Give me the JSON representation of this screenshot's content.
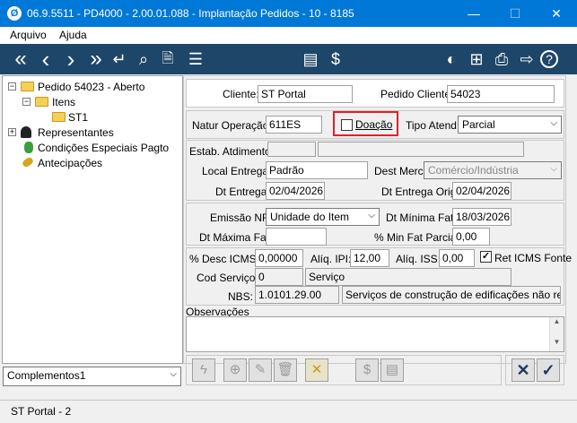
{
  "window": {
    "title": "06.9.5511 - PD4000 - 2.00.01.088 - Implantação Pedidos - 10 - 8185",
    "icon": "app-logo-icon",
    "minimize": "—",
    "maximize": "☐",
    "close": "✕"
  },
  "menu": {
    "arquivo": "Arquivo",
    "ajuda": "Ajuda"
  },
  "toolbar": {
    "first": "«",
    "prev": "‹",
    "next": "›",
    "last": "»",
    "return": "↵",
    "search": "⌕",
    "doc": "🗎",
    "filters": "☰",
    "report": "▤",
    "money": "$",
    "globe": "◐",
    "grid": "⊞",
    "print": "⎙",
    "exit": "⇨",
    "help": "?"
  },
  "tree": {
    "items": [
      {
        "label": "Pedido 54023 - Aberto"
      },
      {
        "label": "Itens"
      },
      {
        "label": "ST1"
      },
      {
        "label": "Representantes"
      },
      {
        "label": "Condições Especiais Pagto"
      },
      {
        "label": "Antecipações"
      }
    ]
  },
  "complementos": {
    "value": "Complementos1"
  },
  "cliente": {
    "label": "Cliente:",
    "value": "ST Portal"
  },
  "pedido_cliente": {
    "label": "Pedido Cliente:",
    "value": "54023"
  },
  "natur_operacao": {
    "label": "Natur Operação:",
    "value": "611ES"
  },
  "doacao": {
    "label": "Doação",
    "checked": false
  },
  "tipo_atend": {
    "label": "Tipo Atend:",
    "value": "Parcial"
  },
  "estab_atendimento": {
    "label": "Estab. Atdimento:",
    "value": ""
  },
  "local_entrega": {
    "label": "Local Entrega:",
    "value": "Padrão"
  },
  "dest_merc": {
    "label": "Dest Merc:",
    "value": "Comércio/Indústria"
  },
  "dt_entrega": {
    "label": "Dt Entrega:",
    "value": "02/04/2026"
  },
  "dt_entrega_orig": {
    "label": "Dt Entrega Orig:",
    "value": "02/04/2026"
  },
  "emissao_nf": {
    "label": "Emissão NF:",
    "value": "Unidade do Item"
  },
  "dt_minima_fat": {
    "label": "Dt Mínima Fat:",
    "value": "18/03/2026"
  },
  "dt_maxima_fat": {
    "label": "Dt Máxima Fat:",
    "value": ""
  },
  "min_fat_parcial": {
    "label": "% Min Fat Parcial:",
    "value": "0,00"
  },
  "desc_icms": {
    "label": "% Desc ICMS:",
    "value": "0,00000"
  },
  "aliq_ipi": {
    "label": "Alíq. IPI:",
    "value": "12,00"
  },
  "aliq_iss": {
    "label": "Alíq. ISS:",
    "value": "0,00"
  },
  "ret_icms_fonte": {
    "label": "Ret ICMS Fonte",
    "checked": true
  },
  "cod_servico": {
    "label": "Cod Serviço:",
    "value": "0",
    "desc": "Serviço"
  },
  "nbs": {
    "label": "NBS:",
    "value": "1.0101.29.00",
    "desc": "Serviços de construção de edificações não resider"
  },
  "observacoes": {
    "label": "Observações",
    "value": ""
  },
  "status": {
    "text": "ST Portal - 2"
  },
  "colors": {
    "titlebar": "#0078d7",
    "toolbar": "#1e4669",
    "highlight": "#e0202a"
  }
}
